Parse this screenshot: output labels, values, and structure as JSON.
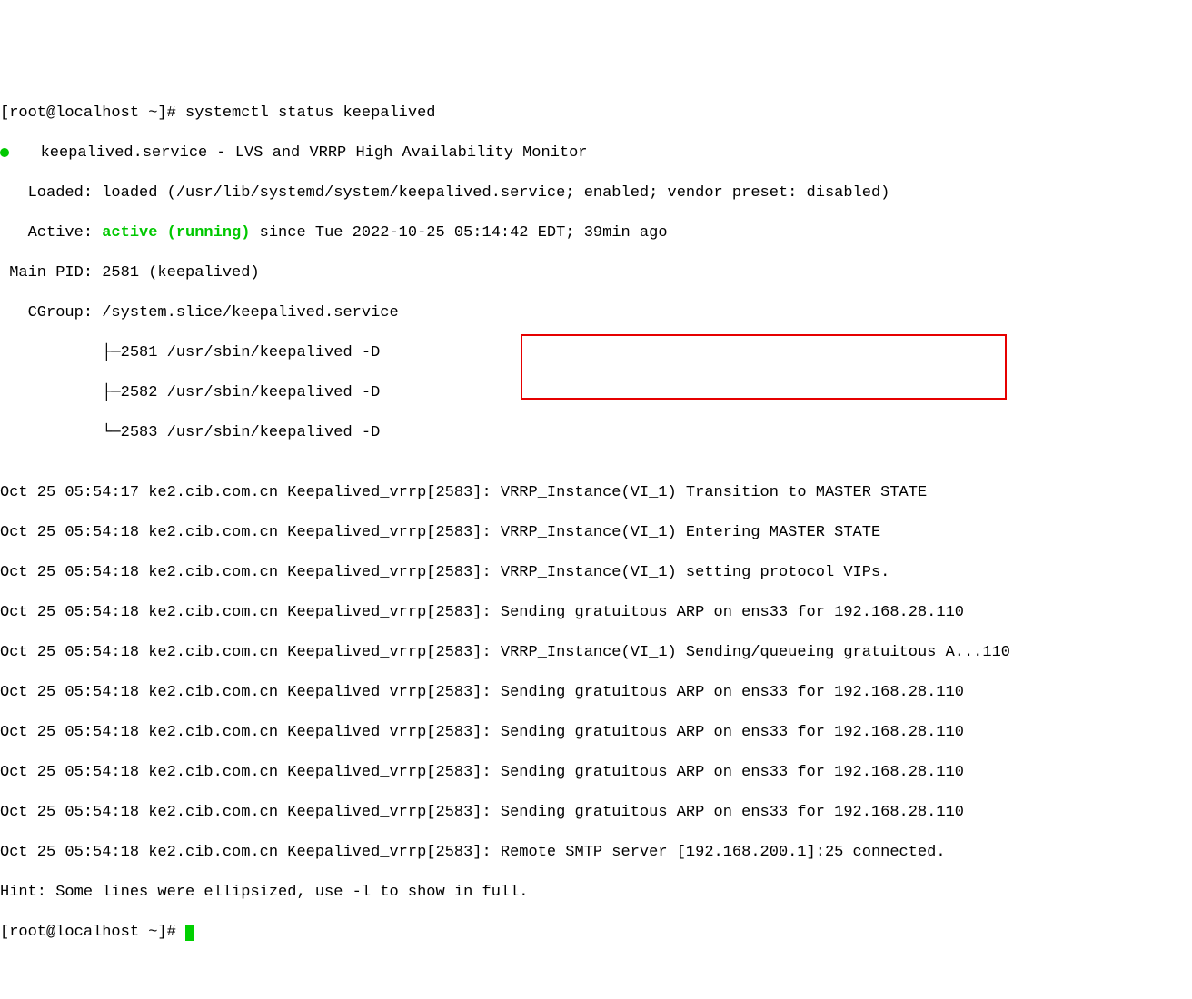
{
  "prompt1": "[root@localhost ~]# ",
  "cmd": "systemctl status keepalived",
  "svc_line_prefix": "   keepalived.service - ",
  "svc_line_desc": "LVS and VRRP High Availability Monitor",
  "loaded": "   Loaded: loaded (/usr/lib/systemd/system/keepalived.service; enabled; vendor preset: disabled)",
  "active_label": "   Active: ",
  "active_state": "active (running)",
  "active_since": " since Tue 2022-10-25 05:14:42 EDT; 39min ago",
  "mainpid": " Main PID: 2581 (keepalived)",
  "cgroup": "   CGroup: /system.slice/keepalived.service",
  "proc1": "           ├─2581 /usr/sbin/keepalived -D",
  "proc2": "           ├─2582 /usr/sbin/keepalived -D",
  "proc3": "           └─2583 /usr/sbin/keepalived -D",
  "blank": "",
  "log1": "Oct 25 05:54:17 ke2.cib.com.cn Keepalived_vrrp[2583]: VRRP_Instance(VI_1) Transition to MASTER STATE",
  "log2": "Oct 25 05:54:18 ke2.cib.com.cn Keepalived_vrrp[2583]: VRRP_Instance(VI_1) Entering MASTER STATE",
  "log3": "Oct 25 05:54:18 ke2.cib.com.cn Keepalived_vrrp[2583]: VRRP_Instance(VI_1) setting protocol VIPs.",
  "log4": "Oct 25 05:54:18 ke2.cib.com.cn Keepalived_vrrp[2583]: Sending gratuitous ARP on ens33 for 192.168.28.110",
  "log5": "Oct 25 05:54:18 ke2.cib.com.cn Keepalived_vrrp[2583]: VRRP_Instance(VI_1) Sending/queueing gratuitous A...110",
  "log6": "Oct 25 05:54:18 ke2.cib.com.cn Keepalived_vrrp[2583]: Sending gratuitous ARP on ens33 for 192.168.28.110",
  "log7": "Oct 25 05:54:18 ke2.cib.com.cn Keepalived_vrrp[2583]: Sending gratuitous ARP on ens33 for 192.168.28.110",
  "log8": "Oct 25 05:54:18 ke2.cib.com.cn Keepalived_vrrp[2583]: Sending gratuitous ARP on ens33 for 192.168.28.110",
  "log9": "Oct 25 05:54:18 ke2.cib.com.cn Keepalived_vrrp[2583]: Sending gratuitous ARP on ens33 for 192.168.28.110",
  "log10": "Oct 25 05:54:18 ke2.cib.com.cn Keepalived_vrrp[2583]: Remote SMTP server [192.168.200.1]:25 connected.",
  "hint": "Hint: Some lines were ellipsized, use -l to show in full.",
  "prompt2": "[root@localhost ~]# "
}
